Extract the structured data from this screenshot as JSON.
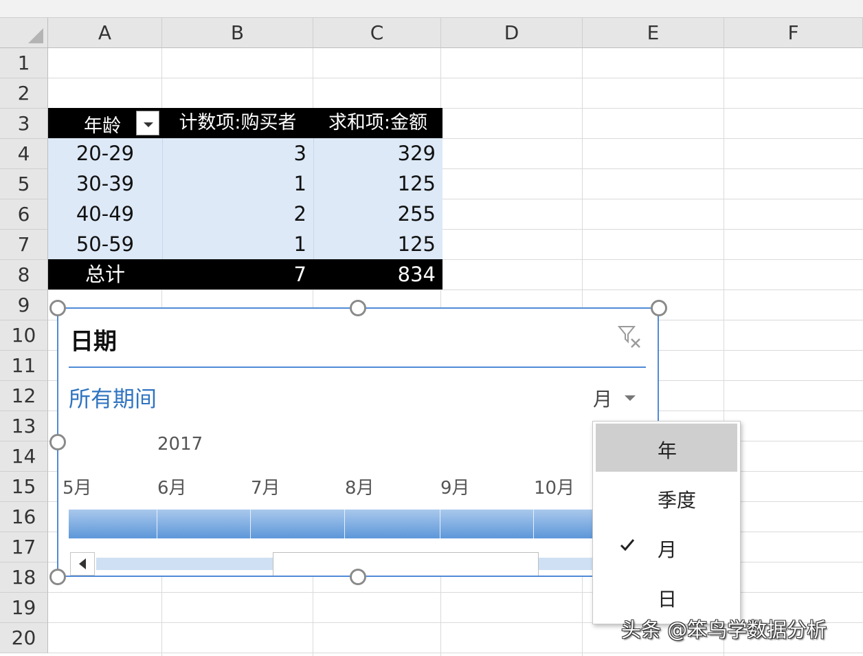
{
  "columns": [
    "A",
    "B",
    "C",
    "D",
    "E",
    "F"
  ],
  "rows": [
    "1",
    "2",
    "3",
    "4",
    "5",
    "6",
    "7",
    "8",
    "9",
    "10",
    "11",
    "12",
    "13",
    "14",
    "15",
    "16",
    "17",
    "18",
    "19",
    "20"
  ],
  "pivot": {
    "headers": [
      "年龄",
      "计数项:购买者",
      "求和项:金额"
    ],
    "rows": [
      {
        "age": "20-29",
        "count": "3",
        "sum": "329"
      },
      {
        "age": "30-39",
        "count": "1",
        "sum": "125"
      },
      {
        "age": "40-49",
        "count": "2",
        "sum": "255"
      },
      {
        "age": "50-59",
        "count": "1",
        "sum": "125"
      }
    ],
    "total": {
      "label": "总计",
      "count": "7",
      "sum": "834"
    }
  },
  "slicer": {
    "title": "日期",
    "period_label": "所有期间",
    "level_selected": "月",
    "year": "2017",
    "months": [
      "5月",
      "6月",
      "7月",
      "8月",
      "9月",
      "10月"
    ],
    "clear_filter_icon": "filter-clear-icon"
  },
  "level_menu": {
    "items": [
      "年",
      "季度",
      "月",
      "日"
    ],
    "checked_index": 2,
    "hover_index": 0
  },
  "watermark": "头条 @笨鸟学数据分析",
  "colors": {
    "accent": "#4f8ad6",
    "pivot_header": "#000000",
    "pivot_cell": "#dde9f7",
    "period_text": "#2f74c0"
  }
}
